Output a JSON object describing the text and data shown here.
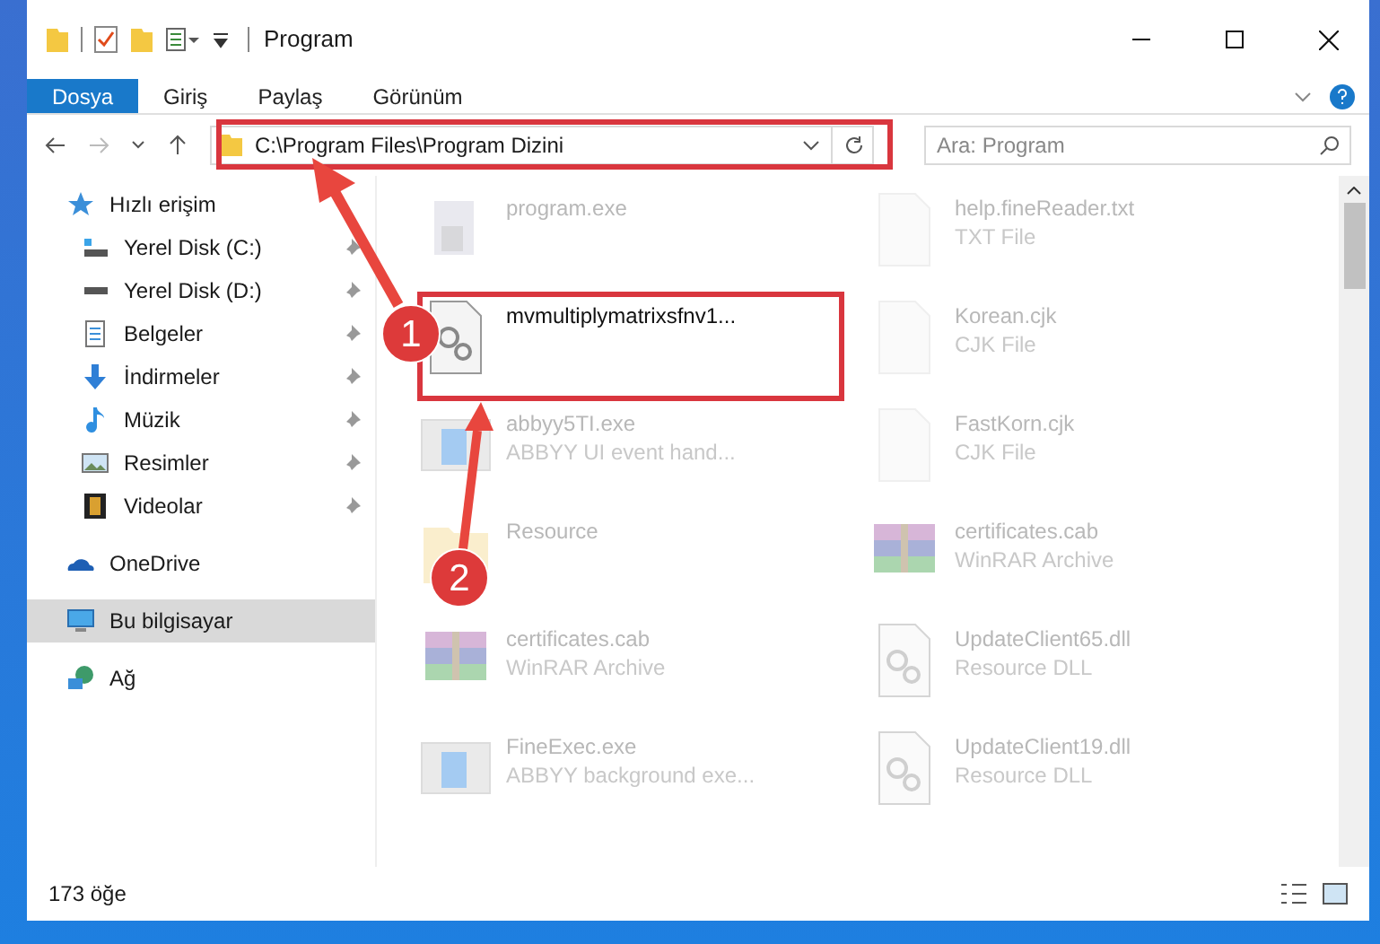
{
  "window": {
    "title": "Program"
  },
  "ribbon_tabs": [
    {
      "label": "Dosya",
      "selected": true
    },
    {
      "label": "Giriş",
      "selected": false
    },
    {
      "label": "Paylaş",
      "selected": false
    },
    {
      "label": "Görünüm",
      "selected": false
    }
  ],
  "address_bar": {
    "path": "C:\\Program Files\\Program Dizini"
  },
  "search": {
    "placeholder": "Ara: Program"
  },
  "sidebar": {
    "items": [
      {
        "label": "Hızlı erişim",
        "selected": false,
        "children": [
          {
            "label": "Yerel Disk (C:)",
            "pinned": true
          },
          {
            "label": "Yerel Disk (D:)",
            "pinned": true
          },
          {
            "label": "Belgeler",
            "pinned": true
          },
          {
            "label": "İndirmeler",
            "pinned": true
          },
          {
            "label": "Müzik",
            "pinned": true
          },
          {
            "label": "Resimler",
            "pinned": true
          },
          {
            "label": "Videolar",
            "pinned": true
          }
        ]
      },
      {
        "label": "OneDrive",
        "selected": false
      },
      {
        "label": "Bu bilgisayar",
        "selected": true
      },
      {
        "label": "Ağ",
        "selected": false
      }
    ]
  },
  "files": [
    {
      "name": "program.exe",
      "faded": true
    },
    {
      "name": "help.fineReader.txt",
      "type": "TXT File",
      "faded": true
    },
    {
      "name": "mvmultiplymatrixsfnv1...",
      "faded": false
    },
    {
      "name": "Korean.cjk",
      "type": "CJK File",
      "faded": true
    },
    {
      "name": "abbyy5TI.exe",
      "type": "ABBYY UI event hand...",
      "faded": true
    },
    {
      "name": "FastKorn.cjk",
      "type": "CJK File",
      "faded": true
    },
    {
      "name": "Resource",
      "faded": true
    },
    {
      "name": "certificates.cab",
      "type": "WinRAR Archive",
      "faded": true
    },
    {
      "name": "certificates.cab",
      "type": "WinRAR Archive",
      "faded": true
    },
    {
      "name": "UpdateClient65.dll",
      "type": "Resource DLL",
      "faded": true
    },
    {
      "name": "FineExec.exe",
      "type": "ABBYY background exe...",
      "faded": true
    },
    {
      "name": "UpdateClient19.dll",
      "type": "Resource DLL",
      "faded": true
    }
  ],
  "status_bar": {
    "item_count": "173 öğe"
  },
  "annotations": [
    {
      "label": "1"
    },
    {
      "label": "2"
    }
  ]
}
